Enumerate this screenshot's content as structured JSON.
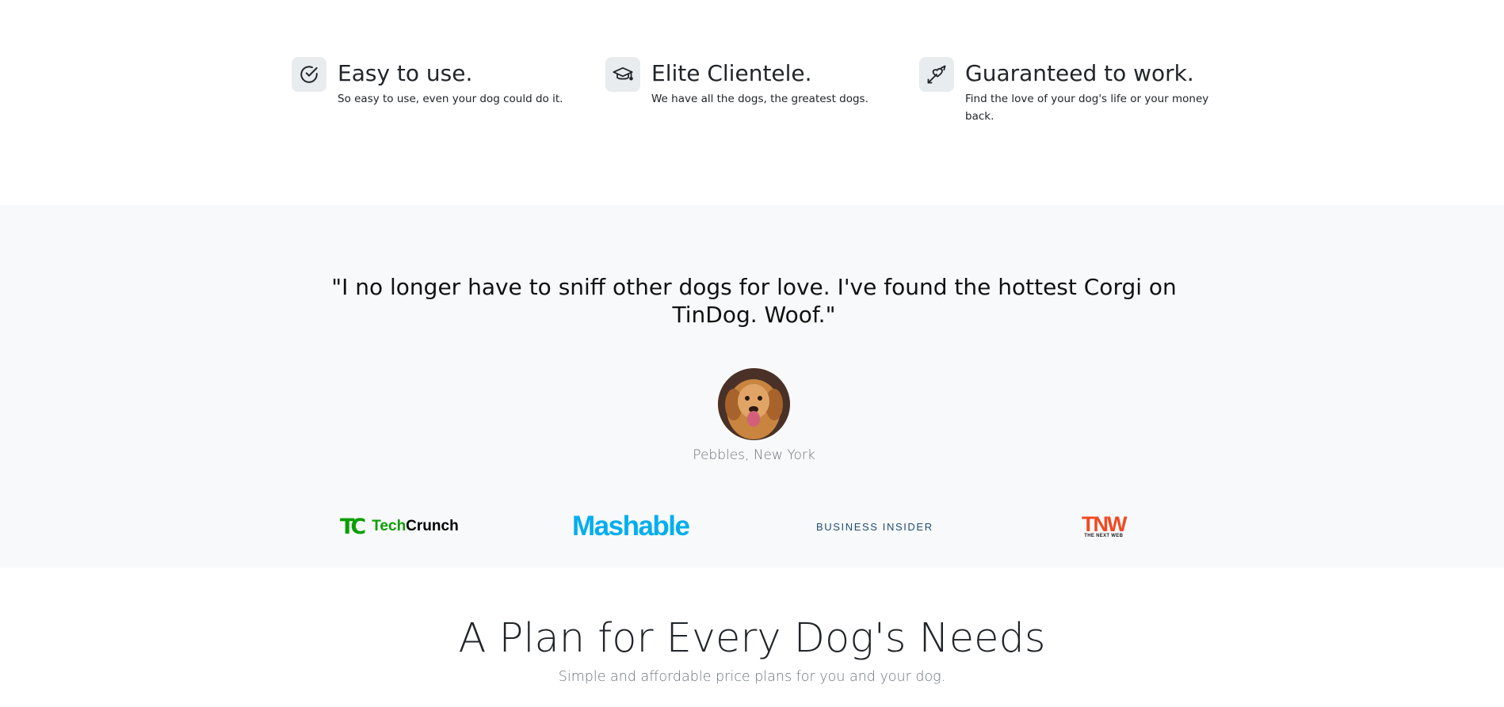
{
  "features": [
    {
      "icon": "check-circle-icon",
      "title": "Easy to use.",
      "text": "So easy to use, even your dog could do it."
    },
    {
      "icon": "graduation-cap-icon",
      "title": "Elite Clientele.",
      "text": "We have all the dogs, the greatest dogs."
    },
    {
      "icon": "heart-arrow-icon",
      "title": "Guaranteed to work.",
      "text": "Find the love of your dog's life or your money back."
    }
  ],
  "testimonial": {
    "quote": "\"I no longer have to sniff other dogs for love. I've found the hottest Corgi on TinDog. Woof.\"",
    "author": "Pebbles, New York"
  },
  "press_logos": {
    "techcrunch": {
      "mark": "TC",
      "text_a": "Tech",
      "text_b": "Crunch"
    },
    "mashable": "Mashable",
    "business_insider": "BUSINESS INSIDER",
    "tnw": {
      "mark": "TNW",
      "sub": "THE NEXT WEB"
    }
  },
  "pricing": {
    "title": "A Plan for Every Dog's Needs",
    "subtitle": "Simple and affordable price plans for you and your dog."
  },
  "colors": {
    "section_alt_bg": "#f8f9fa",
    "icon_box_bg": "#e9ecef",
    "techcrunch_green": "#0a9e01",
    "mashable_blue": "#00aeef",
    "business_insider_blue": "#1f4e79",
    "tnw_orange": "#f24822"
  }
}
